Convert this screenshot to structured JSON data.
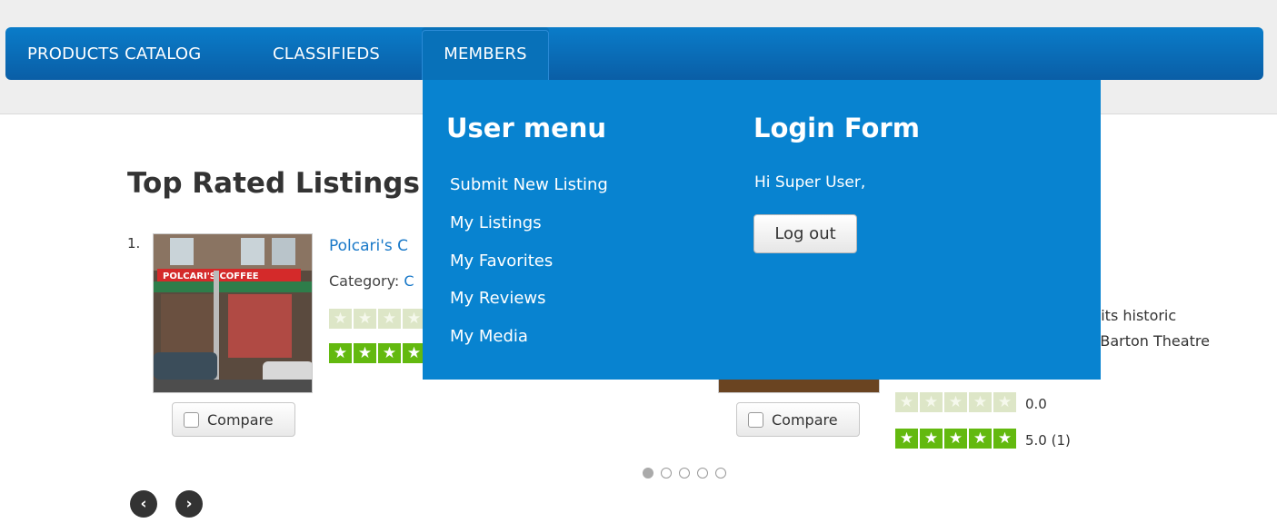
{
  "nav": {
    "items": [
      {
        "label": "PRODUCTS CATALOG"
      },
      {
        "label": "CLASSIFIEDS"
      },
      {
        "label": "MEMBERS"
      }
    ]
  },
  "section": {
    "title": "Top Rated Listings"
  },
  "listings": [
    {
      "rank": "1.",
      "title": "Polcari's C",
      "category_label": "Category: ",
      "category_value": "C",
      "compare_label": "Compare"
    },
    {
      "compare_label": "Compare",
      "description_lines": [
        "n its historic",
        "k Barton Theatre"
      ],
      "user_rating": "0.0",
      "editor_rating": "5.0 (1)"
    }
  ],
  "carousel": {
    "dot_count": 5,
    "active_index": 0
  },
  "dropdown": {
    "user_menu": {
      "heading": "User menu",
      "items": [
        "Submit New Listing",
        "My Listings",
        "My Favorites",
        "My Reviews",
        "My Media"
      ]
    },
    "login_form": {
      "heading": "Login Form",
      "greeting": "Hi Super User,",
      "logout_label": "Log out"
    }
  },
  "icons": {
    "prev": "chevron-left-icon",
    "next": "chevron-right-icon",
    "star": "star-icon"
  },
  "colors": {
    "nav": "#0a6db8",
    "dropdown": "#0883d0",
    "link": "#1878c8",
    "star_full": "#63b90f",
    "star_empty": "#dde6c7"
  }
}
